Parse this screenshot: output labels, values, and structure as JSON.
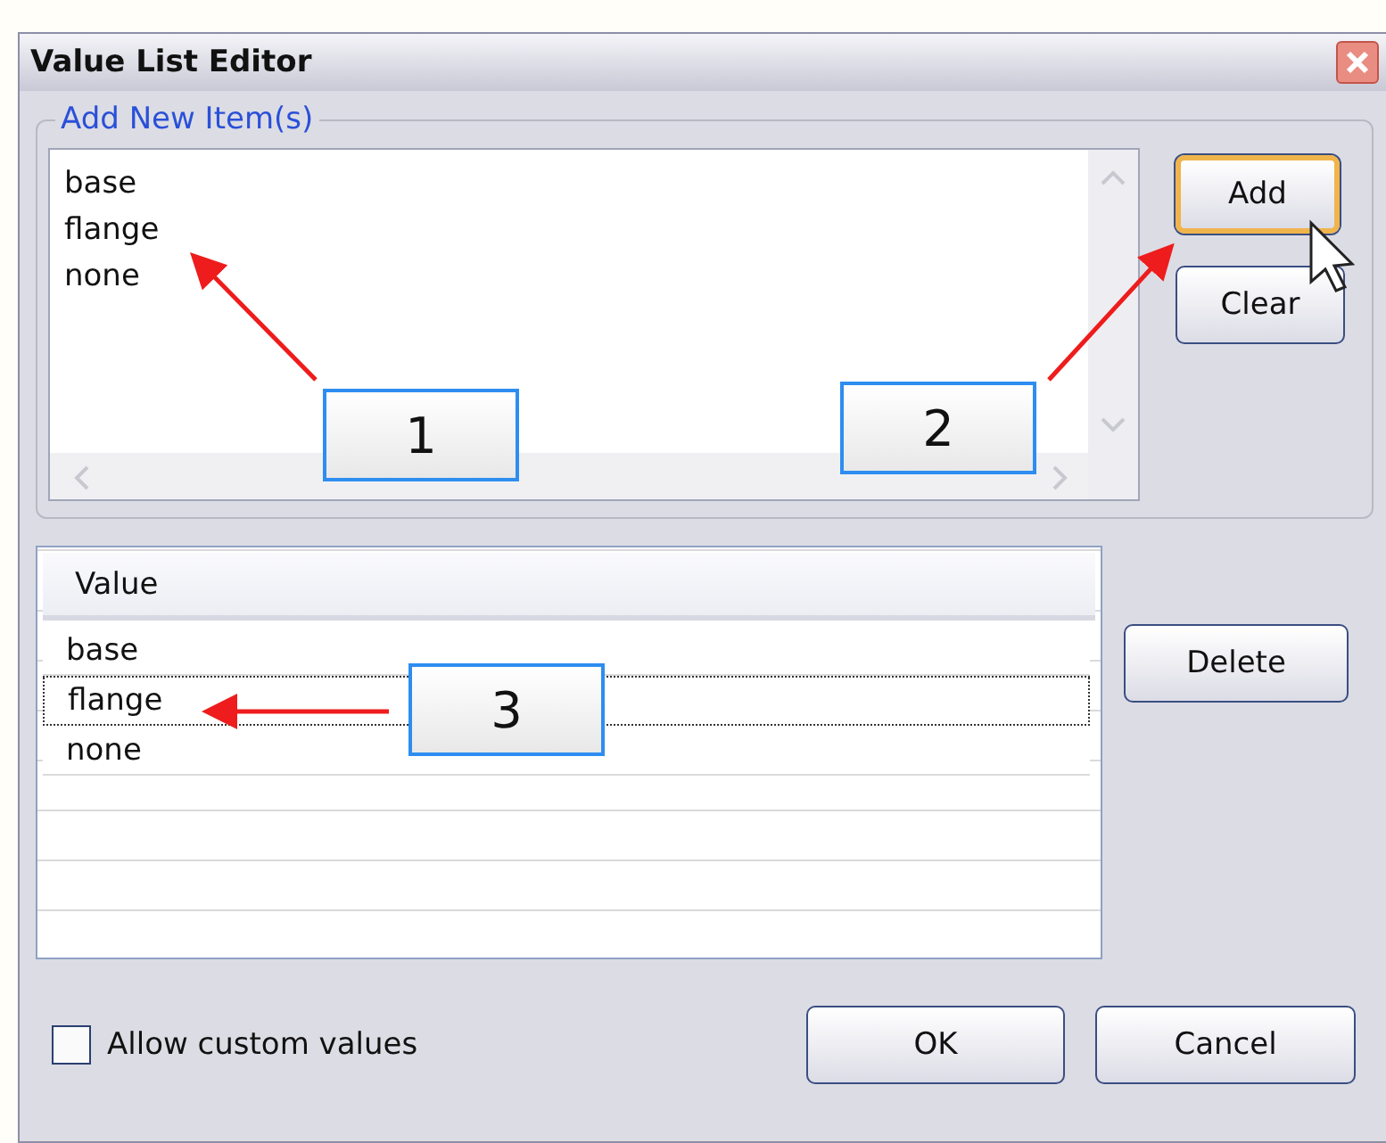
{
  "window": {
    "title": "Value List Editor"
  },
  "add_group": {
    "title": "Add New Item(s)",
    "items": [
      "base",
      "flange",
      "none"
    ]
  },
  "add_buttons": [
    {
      "label": "Add",
      "focused": true
    },
    {
      "label": "Clear",
      "focused": false
    }
  ],
  "value_list": {
    "column": "Value",
    "rows": [
      {
        "value": "base",
        "selected": false
      },
      {
        "value": "flange",
        "selected": true
      },
      {
        "value": "none",
        "selected": false
      }
    ]
  },
  "delete_button": "Delete",
  "allow_custom": {
    "label": "Allow custom values",
    "checked": false
  },
  "footer_buttons": [
    "OK",
    "Cancel"
  ],
  "callouts": [
    "1",
    "2",
    "3"
  ]
}
